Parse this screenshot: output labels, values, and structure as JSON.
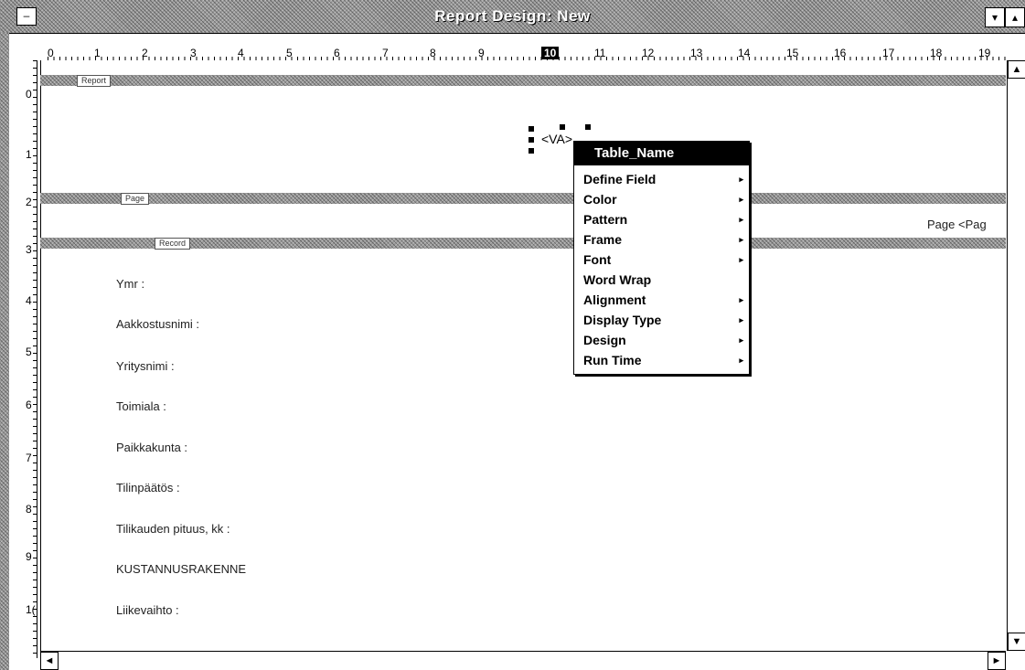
{
  "window": {
    "title": "Report Design: New",
    "system_menu": "–",
    "minimize": "▾",
    "maximize": "▴"
  },
  "ruler": {
    "h_labels": [
      "0",
      "1",
      "2",
      "3",
      "4",
      "5",
      "6",
      "7",
      "8",
      "9",
      "10",
      "11",
      "12",
      "13",
      "14",
      "15",
      "16",
      "17",
      "18",
      "19"
    ],
    "h_selected": "10",
    "v_labels": [
      "0",
      "1",
      "2",
      "3",
      "4",
      "5",
      "6",
      "7",
      "8",
      "9",
      "1("
    ]
  },
  "bands": {
    "report": "Report",
    "page": "Page",
    "record": "Record"
  },
  "canvas": {
    "selected_field_text": "<VA>",
    "page_field_text": "Page <Pag",
    "fields": [
      "Ymr :",
      "Aakkostusnimi :",
      "Yritysnimi :",
      "Toimiala :",
      "Paikkakunta :",
      "Tilinpäätös :",
      "Tilikauden pituus, kk :",
      "KUSTANNUSRAKENNE",
      "Liikevaihto :"
    ]
  },
  "context_menu": {
    "header": "Table_Name",
    "items": [
      {
        "label": "Define Field",
        "has_submenu": true
      },
      {
        "label": "Color",
        "has_submenu": true
      },
      {
        "label": "Pattern",
        "has_submenu": true
      },
      {
        "label": "Frame",
        "has_submenu": true
      },
      {
        "label": "Font",
        "has_submenu": true
      },
      {
        "label": "Word Wrap",
        "has_submenu": false
      },
      {
        "label": "Alignment",
        "has_submenu": true
      },
      {
        "label": "Display Type",
        "has_submenu": true
      },
      {
        "label": "Design",
        "has_submenu": true
      },
      {
        "label": "Run Time",
        "has_submenu": true
      }
    ],
    "submenu_marker": "▸"
  },
  "scroll": {
    "up": "▲",
    "down": "▼",
    "left": "◄",
    "right": "►"
  }
}
